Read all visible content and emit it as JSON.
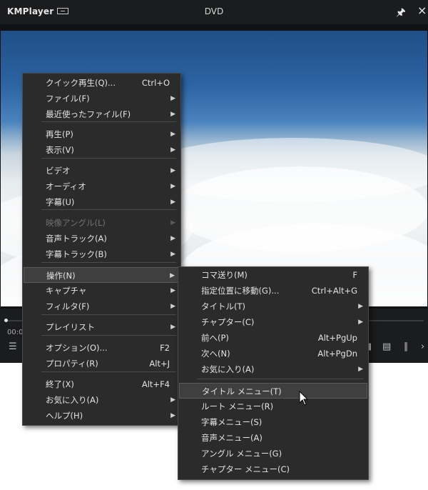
{
  "window": {
    "app_name": "KMPlayer",
    "title": "DVD",
    "time": "00:0"
  },
  "main_menu": [
    {
      "label": "クイック再生(Q)...",
      "shortcut": "Ctrl+O",
      "arrow": false,
      "disabled": false
    },
    {
      "label": "ファイル(F)",
      "shortcut": "",
      "arrow": true,
      "disabled": false
    },
    {
      "label": "最近使ったファイル(F)",
      "shortcut": "",
      "arrow": true,
      "disabled": false
    },
    {
      "label": "再生(P)",
      "shortcut": "",
      "arrow": true,
      "disabled": false
    },
    {
      "label": "表示(V)",
      "shortcut": "",
      "arrow": true,
      "disabled": false
    },
    {
      "label": "ビデオ",
      "shortcut": "",
      "arrow": true,
      "disabled": false
    },
    {
      "label": "オーディオ",
      "shortcut": "",
      "arrow": true,
      "disabled": false
    },
    {
      "label": "字幕(U)",
      "shortcut": "",
      "arrow": true,
      "disabled": false
    },
    {
      "label": "映像アングル(L)",
      "shortcut": "",
      "arrow": true,
      "disabled": true
    },
    {
      "label": "音声トラック(A)",
      "shortcut": "",
      "arrow": true,
      "disabled": false
    },
    {
      "label": "字幕トラック(B)",
      "shortcut": "",
      "arrow": true,
      "disabled": false
    },
    {
      "label": "操作(N)",
      "shortcut": "",
      "arrow": true,
      "disabled": false,
      "highlighted": true
    },
    {
      "label": "キャプチャ",
      "shortcut": "",
      "arrow": true,
      "disabled": false
    },
    {
      "label": "フィルタ(F)",
      "shortcut": "",
      "arrow": true,
      "disabled": false
    },
    {
      "label": "プレイリスト",
      "shortcut": "",
      "arrow": true,
      "disabled": false
    },
    {
      "label": "オプション(O)...",
      "shortcut": "F2",
      "arrow": false,
      "disabled": false
    },
    {
      "label": "プロパティ(R)",
      "shortcut": "Alt+J",
      "arrow": false,
      "disabled": false
    },
    {
      "label": "終了(X)",
      "shortcut": "Alt+F4",
      "arrow": false,
      "disabled": false
    },
    {
      "label": "お気に入り(A)",
      "shortcut": "",
      "arrow": true,
      "disabled": false
    },
    {
      "label": "ヘルプ(H)",
      "shortcut": "",
      "arrow": true,
      "disabled": false
    }
  ],
  "sub_menu": [
    {
      "label": "コマ送り(M)",
      "shortcut": "F",
      "arrow": false
    },
    {
      "label": "指定位置に移動(G)...",
      "shortcut": "Ctrl+Alt+G",
      "arrow": false
    },
    {
      "label": "タイトル(T)",
      "shortcut": "",
      "arrow": true
    },
    {
      "label": "チャプター(C)",
      "shortcut": "",
      "arrow": true
    },
    {
      "label": "前へ(P)",
      "shortcut": "Alt+PgUp",
      "arrow": false
    },
    {
      "label": "次へ(N)",
      "shortcut": "Alt+PgDn",
      "arrow": false
    },
    {
      "label": "お気に入り(A)",
      "shortcut": "",
      "arrow": true
    },
    {
      "label": "タイトル メニュー(T)",
      "shortcut": "",
      "arrow": false,
      "highlighted": true
    },
    {
      "label": "ルート メニュー(R)",
      "shortcut": "",
      "arrow": false
    },
    {
      "label": "字幕メニュー(S)",
      "shortcut": "",
      "arrow": false
    },
    {
      "label": "音声メニュー(A)",
      "shortcut": "",
      "arrow": false
    },
    {
      "label": "アングル メニュー(G)",
      "shortcut": "",
      "arrow": false
    },
    {
      "label": "チャプター メニュー(C)",
      "shortcut": "",
      "arrow": false
    }
  ]
}
